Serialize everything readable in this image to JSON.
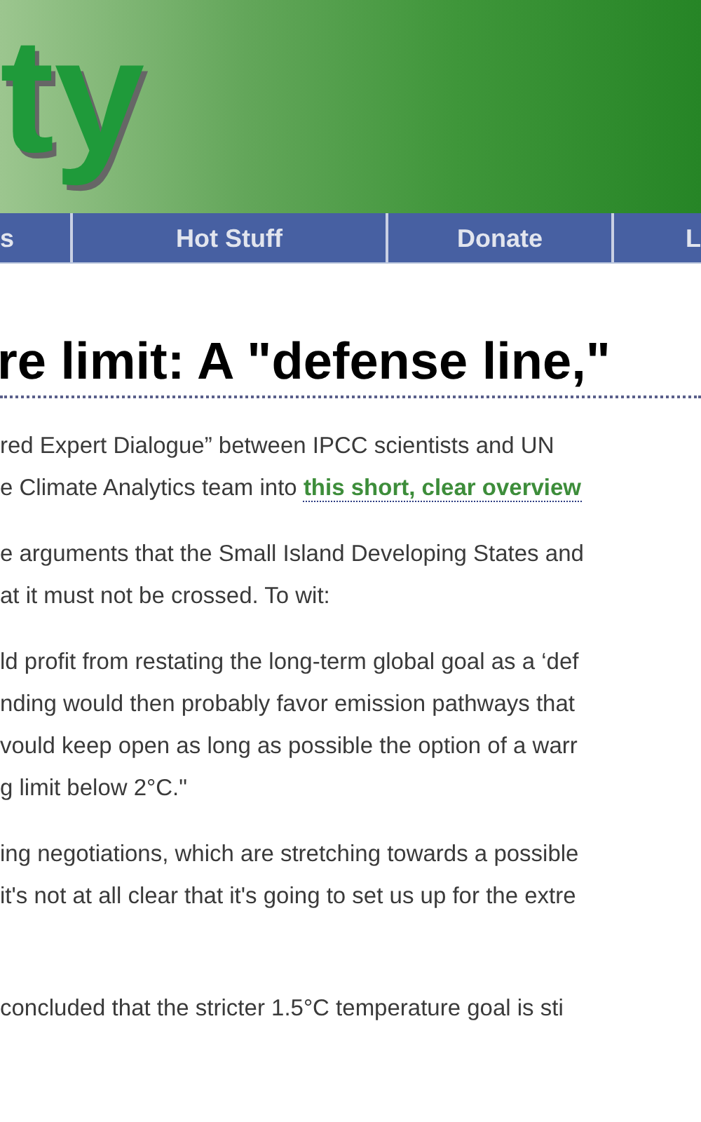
{
  "header": {
    "logo": "ty"
  },
  "nav": [
    "s",
    "Hot Stuff",
    "Donate",
    "L"
  ],
  "title": "re limit: A \"defense line,\"",
  "paragraphs": [
    {
      "kind": "normal",
      "lines": [
        [
          {
            "kind": "text",
            "text": "red Expert Dialogue” between IPCC scientists and UN"
          }
        ],
        [
          {
            "kind": "text",
            "text": "e Climate Analytics team into "
          },
          {
            "kind": "link",
            "text": "this short, clear overview"
          }
        ]
      ]
    },
    {
      "kind": "normal",
      "lines": [
        [
          {
            "kind": "text",
            "text": "e arguments that the Small Island Developing States and"
          }
        ],
        [
          {
            "kind": "text",
            "text": "at it must not be crossed.  To wit:"
          }
        ]
      ]
    },
    {
      "kind": "quote",
      "lines": [
        [
          {
            "kind": "text",
            "text": "ld profit from restating the long-term global goal as a ‘def"
          }
        ],
        [
          {
            "kind": "text",
            "text": "nding would then probably favor emission pathways that"
          }
        ],
        [
          {
            "kind": "text",
            "text": "vould keep open as long as possible the option of a warr"
          }
        ],
        [
          {
            "kind": "text",
            "text": "g limit below 2°C.\""
          }
        ]
      ]
    },
    {
      "kind": "normal",
      "lines": [
        [
          {
            "kind": "text",
            "text": "ing negotiations, which are stretching towards a possible"
          }
        ],
        [
          {
            "kind": "text",
            "text": "it's not at all clear that it's going to set us up for the extre"
          }
        ]
      ]
    },
    {
      "kind": "spaced",
      "lines": [
        [
          {
            "kind": "text",
            "text": "concluded that the stricter 1.5°C temperature goal is sti"
          }
        ]
      ]
    }
  ]
}
